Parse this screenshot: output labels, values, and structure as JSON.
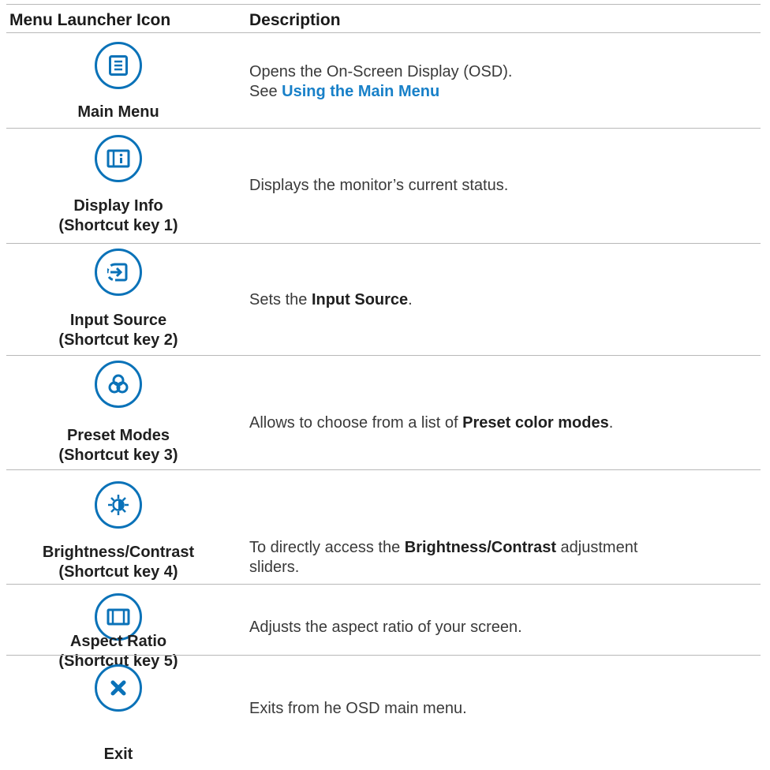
{
  "header": {
    "col1": "Menu Launcher Icon",
    "col2": "Description"
  },
  "rows": [
    {
      "label_line1": "Main Menu",
      "label_line2": "",
      "icon": "menu-list-icon",
      "desc_line1": "Opens the On-Screen Display (OSD).",
      "desc_line2_prefix": "See ",
      "desc_link": "Using the Main Menu"
    },
    {
      "label_line1": "Display Info",
      "label_line2": "(Shortcut key 1)",
      "icon": "info-icon",
      "desc": "Displays the monitor’s current status."
    },
    {
      "label_line1": "Input Source",
      "label_line2": "(Shortcut key 2)",
      "icon": "input-source-icon",
      "desc_prefix": "Sets the ",
      "desc_bold": "Input Source",
      "desc_suffix": "."
    },
    {
      "label_line1": "Preset Modes",
      "label_line2": "(Shortcut key 3)",
      "icon": "preset-modes-icon",
      "desc_prefix": "Allows to choose from a list of ",
      "desc_bold": "Preset color modes",
      "desc_suffix": "."
    },
    {
      "label_line1": "Brightness/Contrast",
      "label_line2": "(Shortcut key 4)",
      "icon": "brightness-icon",
      "desc_prefix": "To directly access the ",
      "desc_bold": "Brightness/Contrast",
      "desc_suffix": " adjustment",
      "desc_line2": "sliders."
    },
    {
      "label_line1": "Aspect Ratio",
      "label_line2": "(Shortcut key 5)",
      "icon": "aspect-ratio-icon",
      "desc": "Adjusts the aspect ratio of your screen."
    },
    {
      "label_line1": "Exit",
      "label_line2": "",
      "icon": "close-icon",
      "desc": "Exits from he OSD main menu."
    }
  ],
  "colors": {
    "accent": "#0a72b8",
    "link": "#1880c8",
    "rule": "#b8b8b8"
  }
}
